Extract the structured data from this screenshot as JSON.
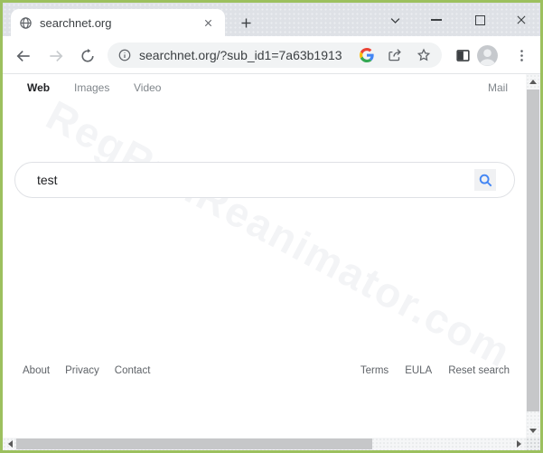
{
  "browser": {
    "tab_title": "searchnet.org",
    "url": "searchnet.org/?sub_id1=7a63b1913"
  },
  "nav": {
    "web": "Web",
    "images": "Images",
    "video": "Video",
    "mail": "Mail"
  },
  "search": {
    "value": "test"
  },
  "watermark": "RegRunReanimator.com",
  "footer": {
    "about": "About",
    "privacy": "Privacy",
    "contact": "Contact",
    "terms": "Terms",
    "eula": "EULA",
    "reset": "Reset search"
  },
  "colors": {
    "frame_green": "#9cc05e",
    "titlebar_gray": "#dee1e6",
    "omnibox_gray": "#f1f3f4",
    "accent_blue": "#4285f4",
    "scroll_thumb": "#c6c7c9"
  }
}
